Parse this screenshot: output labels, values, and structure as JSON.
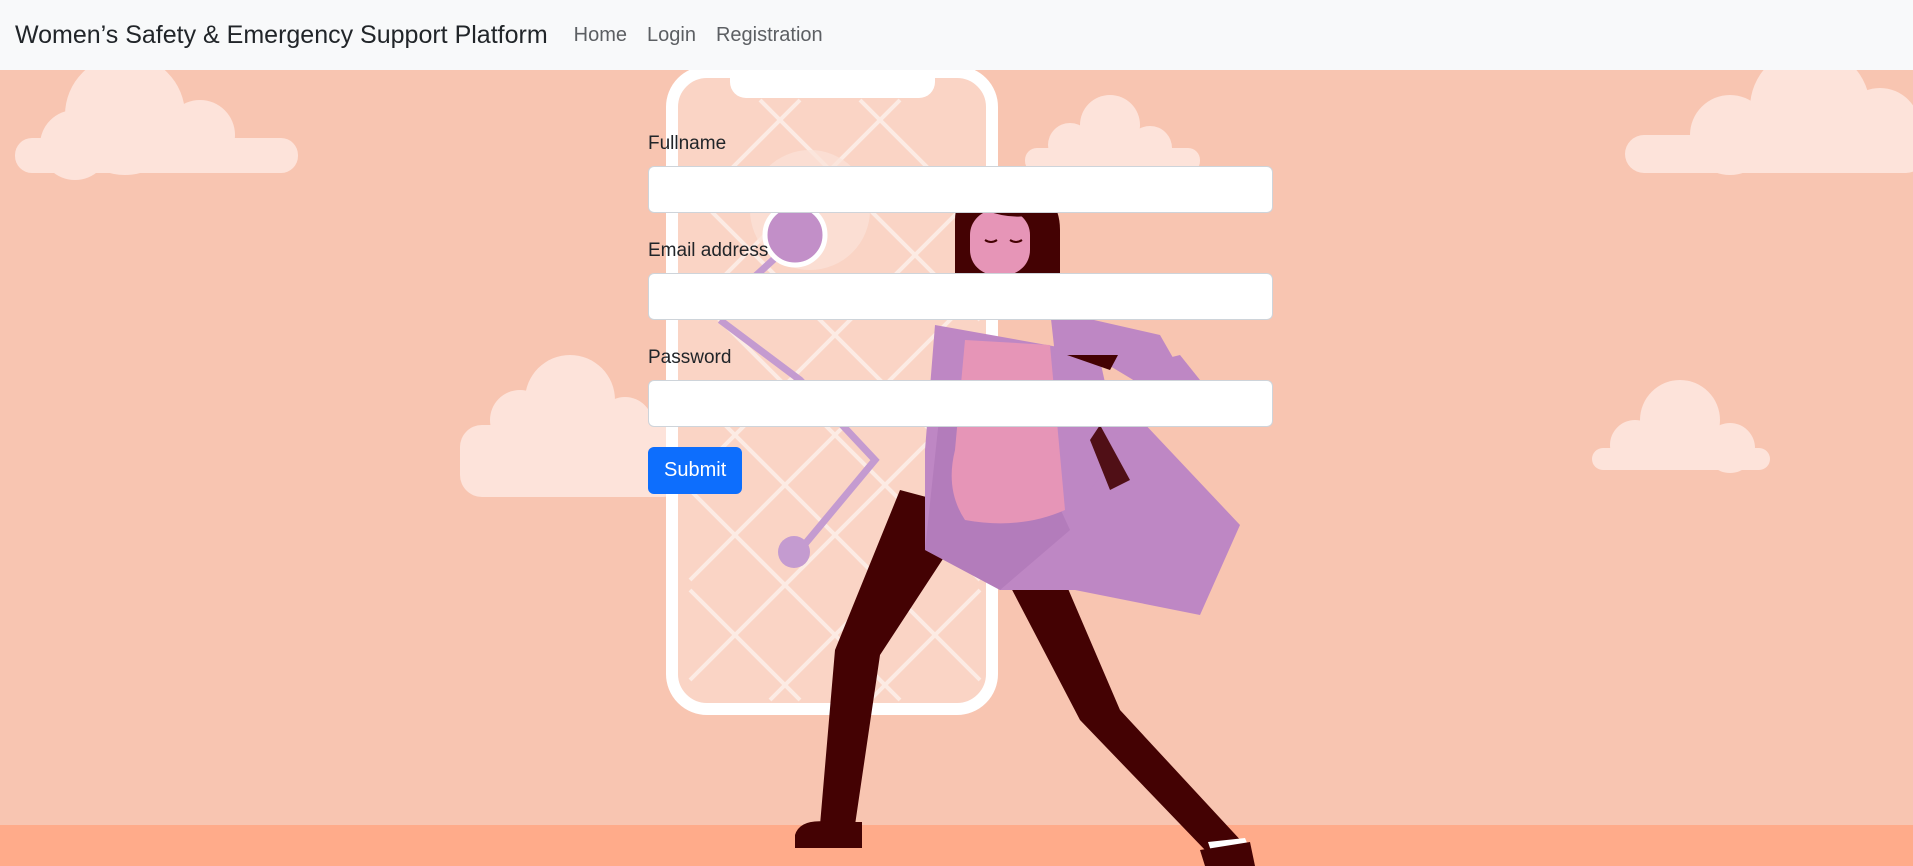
{
  "navbar": {
    "brand": "Women’s Safety & Emergency Support Platform",
    "links": [
      {
        "label": "Home"
      },
      {
        "label": "Login"
      },
      {
        "label": "Registration"
      }
    ]
  },
  "form": {
    "fields": [
      {
        "label": "Fullname",
        "value": "",
        "placeholder": ""
      },
      {
        "label": "Email address",
        "value": "",
        "placeholder": ""
      },
      {
        "label": "Password",
        "value": "",
        "placeholder": ""
      }
    ],
    "submit_label": "Submit"
  },
  "colors": {
    "background": "#f8c5b1",
    "navbar": "#f8f9fa",
    "primary": "#0d6efd",
    "floor": "#ffab8a",
    "cloud": "#fde3da",
    "coat": "#be87c4",
    "pants": "#440203",
    "shirt": "#e695b7"
  },
  "illustration": {
    "name": "woman-walking-phone-map-illustration"
  }
}
